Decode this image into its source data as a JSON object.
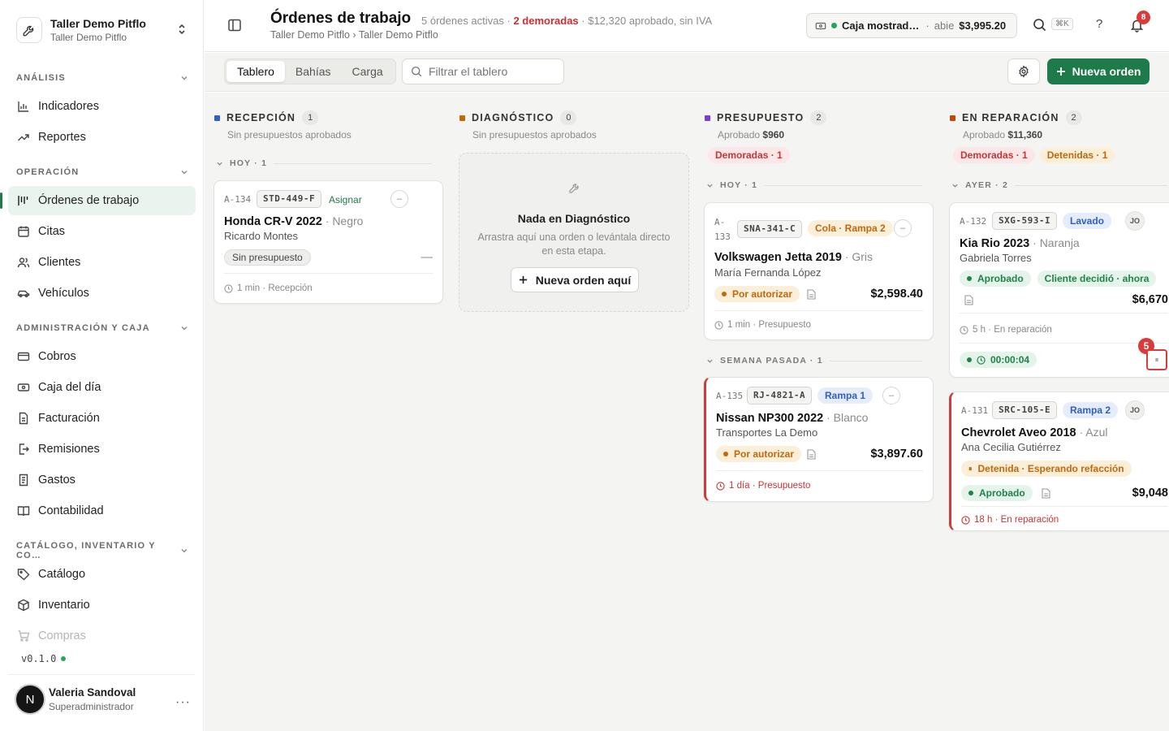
{
  "workspace": {
    "name": "Taller Demo Pitflo",
    "sub": "Taller Demo Pitflo"
  },
  "sidebar": {
    "sections": [
      {
        "label": "ANÁLISIS"
      },
      {
        "label": "OPERACIÓN"
      },
      {
        "label": "ADMINISTRACIÓN Y CAJA"
      },
      {
        "label": "CATÁLOGO, INVENTARIO Y CO…"
      }
    ],
    "items": [
      {
        "label": "Indicadores",
        "icon": "bar-chart-icon"
      },
      {
        "label": "Reportes",
        "icon": "trend-icon"
      },
      {
        "label": "Órdenes de trabajo",
        "icon": "kanban-icon",
        "active": true
      },
      {
        "label": "Citas",
        "icon": "calendar-icon"
      },
      {
        "label": "Clientes",
        "icon": "users-icon"
      },
      {
        "label": "Vehículos",
        "icon": "car-icon"
      },
      {
        "label": "Cobros",
        "icon": "credit-card-icon"
      },
      {
        "label": "Caja del día",
        "icon": "cash-register-icon"
      },
      {
        "label": "Facturación",
        "icon": "invoice-icon"
      },
      {
        "label": "Remisiones",
        "icon": "export-icon"
      },
      {
        "label": "Gastos",
        "icon": "receipt-icon"
      },
      {
        "label": "Contabilidad",
        "icon": "book-icon"
      },
      {
        "label": "Catálogo",
        "icon": "tag-icon"
      },
      {
        "label": "Inventario",
        "icon": "box-icon"
      },
      {
        "label": "Compras",
        "icon": "cart-icon"
      }
    ],
    "version": "v0.1.0",
    "user": {
      "initial": "N",
      "name": "Valeria Sandoval",
      "role": "Superadministrador",
      "more": "···"
    }
  },
  "header": {
    "title": "Órdenes de trabajo",
    "meta_active": "5 órdenes activas · ",
    "meta_late": "2 demoradas",
    "meta_rest": " · $12,320 aprobado, sin IVA",
    "breadcrumb": "Taller Demo Pitflo › Taller Demo Pitflo",
    "cash": {
      "name": "Caja mostrad…",
      "sep": "·",
      "status": "abie",
      "amount": "$3,995.20"
    },
    "shortcut": "⌘K",
    "help": "?",
    "notifications": "8"
  },
  "toolbar": {
    "tabs": [
      "Tablero",
      "Bahías",
      "Carga"
    ],
    "filter_placeholder": "Filtrar el tablero",
    "new_order": "Nueva orden"
  },
  "colors": {
    "accent": "#1f7a49",
    "danger": "#d03a3a",
    "recepcion": "#2f5fc7",
    "diagnostico": "#c2670a",
    "presupuesto": "#7a3fd0",
    "reparacion": "#c2470a"
  },
  "columns": {
    "recepcion": {
      "title": "RECEPCIÓN",
      "count": "1",
      "sub": "Sin presupuestos aprobados"
    },
    "diagnostico": {
      "title": "DIAGNÓSTICO",
      "count": "0",
      "sub": "Sin presupuestos aprobados",
      "empty_title": "Nada en Diagnóstico",
      "empty_desc": "Arrastra aquí una orden o levántala directo en esta etapa.",
      "empty_button": "Nueva orden aquí"
    },
    "presupuesto": {
      "title": "PRESUPUESTO",
      "count": "2",
      "sub_label": "Aprobado ",
      "sub_amount": "$960",
      "pill_late": "Demoradas · 1"
    },
    "reparacion": {
      "title": "EN REPARACIÓN",
      "count": "2",
      "sub_label": "Aprobado ",
      "sub_amount": "$11,360",
      "pill_late": "Demoradas · 1",
      "pill_held": "Detenidas · 1"
    }
  },
  "groups": {
    "hoy": "HOY · 1",
    "hoy2": "HOY · 1",
    "semana": "SEMANA PASADA · 1",
    "ayer": "AYER · 2"
  },
  "cards": {
    "a134": {
      "id": "A-134",
      "plate": "STD-449-F",
      "assign": "Asignar",
      "car": "Honda CR-V 2022",
      "color": " · Negro",
      "customer": "Ricardo Montes",
      "status": "Sin presupuesto",
      "dash": "—",
      "foot": "1 min · Recepción"
    },
    "a133": {
      "id_a": "A-",
      "id_b": "133",
      "plate": "SNA-341-C",
      "tag": "Cola · Rampa 2",
      "car": "Volkswagen Jetta 2019",
      "color": " · Gris",
      "customer": "María Fernanda López",
      "status": "Por autorizar",
      "amount": "$2,598.40",
      "foot": "1 min · Presupuesto"
    },
    "a135": {
      "id": "A-135",
      "plate": "RJ-4821-A",
      "tag": "Rampa 1",
      "car": "Nissan NP300 2022",
      "color": " · Blanco",
      "customer": "Transportes La Demo",
      "status": "Por autorizar",
      "amount": "$3,897.60",
      "foot": "1 día · Presupuesto"
    },
    "a132": {
      "id": "A-132",
      "plate": "SXG-593-I",
      "tag": "Lavado",
      "tech": "JO",
      "car": "Kia Rio 2023",
      "color": " · Naranja",
      "customer": "Gabriela Torres",
      "status": "Aprobado",
      "decided": "Cliente decidió · ahora",
      "amount": "$6,670",
      "foot": "5 h · En reparación",
      "timer": "00:00:04",
      "pending": "5"
    },
    "a131": {
      "id": "A-131",
      "plate": "SRC-105-E",
      "tag": "Rampa 2",
      "tech": "JO",
      "car": "Chevrolet Aveo 2018",
      "color": " · Azul",
      "customer": "Ana Cecilia Gutiérrez",
      "held": "Detenida · Esperando refacción",
      "status": "Aprobado",
      "amount": "$9,048",
      "foot": "18 h · En reparación"
    }
  }
}
